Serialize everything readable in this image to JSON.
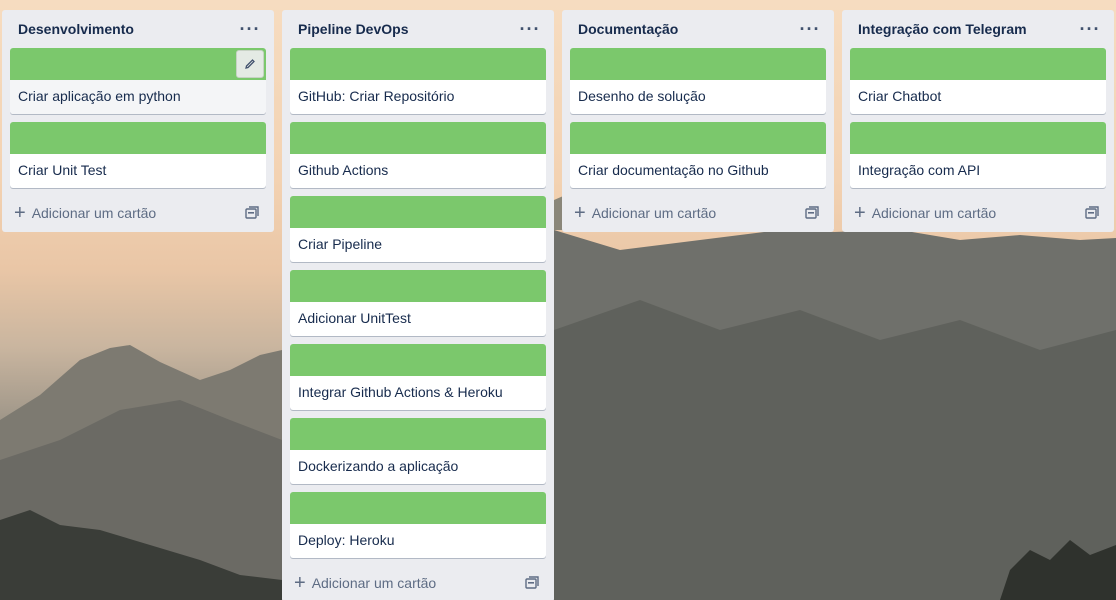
{
  "lists": [
    {
      "title": "Desenvolvimento",
      "cards": [
        {
          "title": "Criar aplicação em python",
          "cover": "#7bc86c"
        },
        {
          "title": "Criar Unit Test",
          "cover": "#7bc86c"
        }
      ],
      "add_label": "Adicionar um cartão"
    },
    {
      "title": "Pipeline DevOps",
      "cards": [
        {
          "title": "GitHub: Criar Repositório",
          "cover": "#7bc86c"
        },
        {
          "title": "Github Actions",
          "cover": "#7bc86c"
        },
        {
          "title": "Criar Pipeline",
          "cover": "#7bc86c"
        },
        {
          "title": "Adicionar UnitTest",
          "cover": "#7bc86c"
        },
        {
          "title": "Integrar Github Actions & Heroku",
          "cover": "#7bc86c"
        },
        {
          "title": "Dockerizando a aplicação",
          "cover": "#7bc86c"
        },
        {
          "title": "Deploy: Heroku",
          "cover": "#7bc86c"
        }
      ],
      "add_label": "Adicionar um cartão"
    },
    {
      "title": "Documentação",
      "cards": [
        {
          "title": "Desenho de solução",
          "cover": "#7bc86c"
        },
        {
          "title": "Criar documentação no Github",
          "cover": "#7bc86c"
        }
      ],
      "add_label": "Adicionar um cartão"
    },
    {
      "title": "Integração com Telegram",
      "cards": [
        {
          "title": "Criar Chatbot",
          "cover": "#7bc86c"
        },
        {
          "title": "Integração com API",
          "cover": "#7bc86c"
        }
      ],
      "add_label": "Adicionar um cartão"
    }
  ],
  "icons": {
    "menu": "ellipsis-icon",
    "add": "plus-icon",
    "template": "card-template-icon",
    "edit": "pencil-icon"
  },
  "colors": {
    "label_green": "#7bc86c",
    "list_bg": "#ebecf0",
    "text": "#172b4d"
  }
}
